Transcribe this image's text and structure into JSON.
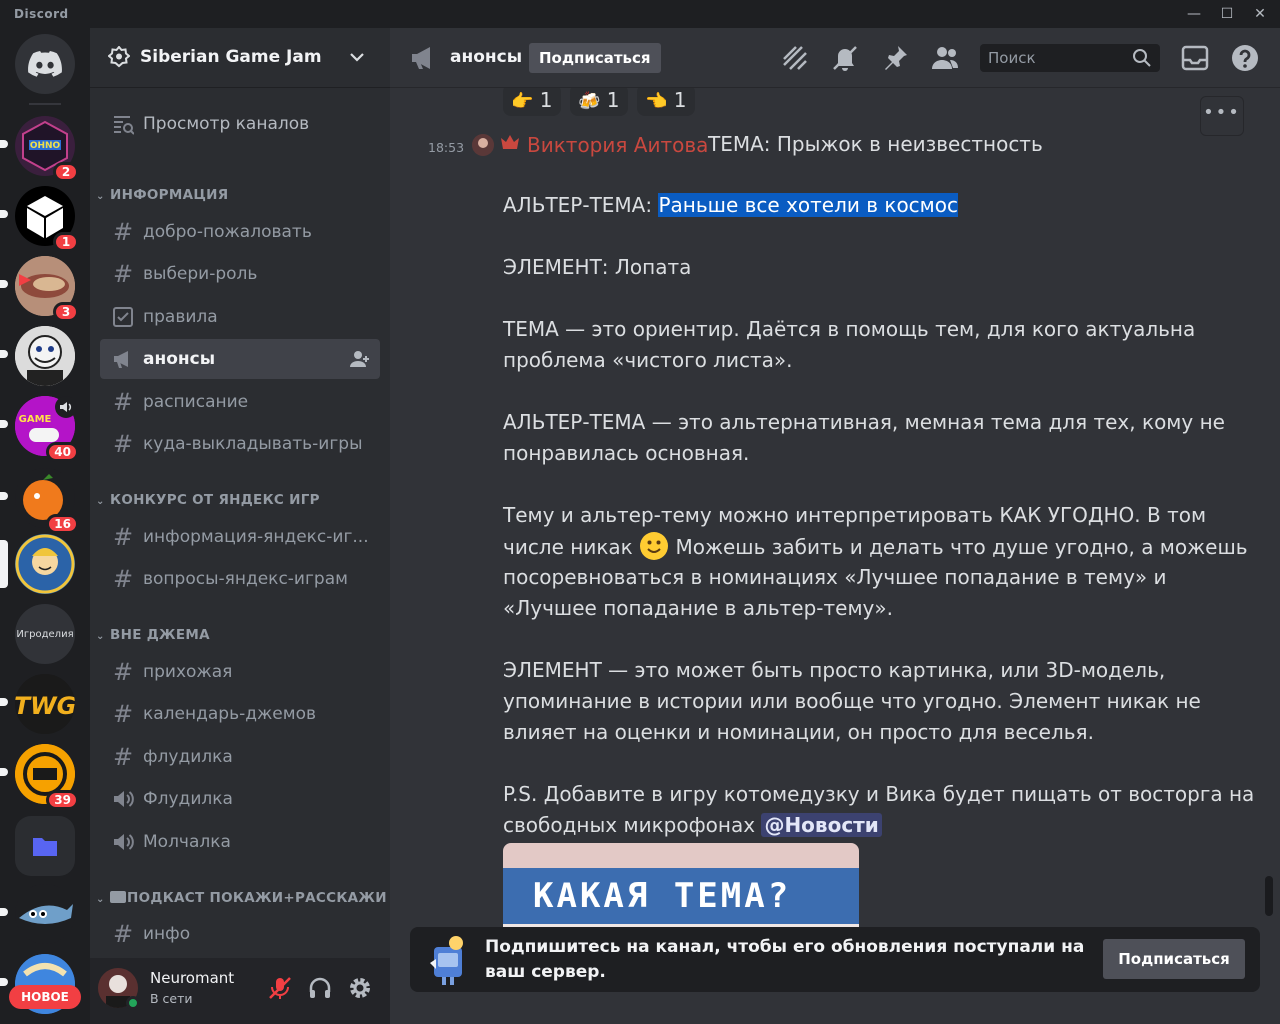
{
  "window": {
    "title": "Discord",
    "minimize": "—",
    "maximize": "☐",
    "close": "✕"
  },
  "servers": [
    {
      "name": "discord-home",
      "badge": ""
    },
    {
      "name": "ohno",
      "badge": "2"
    },
    {
      "name": "cube",
      "badge": "1"
    },
    {
      "name": "food",
      "badge": "3"
    },
    {
      "name": "clown",
      "badge": ""
    },
    {
      "name": "game",
      "badge": "40"
    },
    {
      "name": "orange",
      "badge": "16"
    },
    {
      "name": "vault-boy",
      "badge": ""
    },
    {
      "name": "igrodeliya",
      "label": "Игроделия",
      "badge": ""
    },
    {
      "name": "twg",
      "label": "TWG",
      "badge": ""
    },
    {
      "name": "pgn",
      "badge": "39"
    },
    {
      "name": "folder",
      "badge": ""
    },
    {
      "name": "shark",
      "badge": ""
    },
    {
      "name": "globe",
      "badge": ""
    }
  ],
  "rail": {
    "new_label": "НОВОЕ"
  },
  "guild": {
    "name": "Siberian Game Jam"
  },
  "sidebar": {
    "browse": "Просмотр каналов",
    "categories": [
      {
        "title": "ИНФОРМАЦИЯ",
        "channels": [
          {
            "name": "добро-пожаловать",
            "type": "text"
          },
          {
            "name": "выбери-роль",
            "type": "text"
          },
          {
            "name": "правила",
            "type": "rules"
          },
          {
            "name": "анонсы",
            "type": "announce",
            "active": true
          },
          {
            "name": "расписание",
            "type": "text"
          },
          {
            "name": "куда-выкладывать-игры",
            "type": "text"
          }
        ]
      },
      {
        "title": "КОНКУРС ОТ ЯНДЕКС ИГР",
        "channels": [
          {
            "name": "информация-яндекс-иг...",
            "type": "text"
          },
          {
            "name": "вопросы-яндекс-играм",
            "type": "text"
          }
        ]
      },
      {
        "title": "ВНЕ ДЖЕМА",
        "channels": [
          {
            "name": "прихожая",
            "type": "text"
          },
          {
            "name": "календарь-джемов",
            "type": "text"
          },
          {
            "name": "флудилка",
            "type": "text"
          },
          {
            "name": "Флудилка",
            "type": "voice"
          },
          {
            "name": "Молчалка",
            "type": "voice"
          }
        ]
      },
      {
        "title": "ПОДКАСТ ПОКАЖИ+РАССКАЖИ",
        "channels": [
          {
            "name": "инфо",
            "type": "text"
          }
        ]
      }
    ]
  },
  "user": {
    "name": "Neuromant",
    "status": "В сети"
  },
  "header": {
    "channel": "анонсы",
    "follow": "Подписаться",
    "search_placeholder": "Поиск"
  },
  "reactions": [
    {
      "emoji": "👉",
      "count": "1"
    },
    {
      "emoji": "🍻",
      "count": "1"
    },
    {
      "emoji": "👈",
      "count": "1"
    }
  ],
  "message": {
    "time": "18:53",
    "author": "Виктория Аитова",
    "l1": "ТЕМА: Прыжок в неизвестность",
    "l2a": "АЛЬТЕР-ТЕМА: ",
    "l2b": "Раньше все хотели в космос",
    "l3": "ЭЛЕМЕНТ: Лопата",
    "l4": "ТЕМА — это ориентир. Даётся в помощь тем, для кого актуальна",
    "l5": "проблема «чистого листа».",
    "l6": "АЛЬТЕР-ТЕМА — это альтернативная, мемная тема для тех, кому не",
    "l7": "понравилась основная.",
    "l8": "Тему и альтер-тему можно интерпретировать КАК УГОДНО. В том",
    "l9a": "числе никак ",
    "l9b": " Можешь забить и делать что душе угодно, а можешь",
    "l10": "посоревноваться в номинациях «Лучшее попадание в тему» и",
    "l11": "«Лучшее попадание в альтер-тему».",
    "l12": "ЭЛЕМЕНТ — это может быть просто картинка, или 3D-модель,",
    "l13": "упоминание в истории или вообще что угодно. Элемент никак не",
    "l14": "влияет на оценки и номинации, он просто для веселья.",
    "l15": "P.S. Добавите в игру котомедузку и Вика будет пищать от восторга на",
    "l16a": "свободных микрофонах ",
    "mention": "@Новости",
    "embed_title": "КАКАЯ ТЕМА?"
  },
  "notice": {
    "text": "Подпишитесь на канал, чтобы его обновления поступали на ваш сервер.",
    "button": "Подписаться"
  }
}
